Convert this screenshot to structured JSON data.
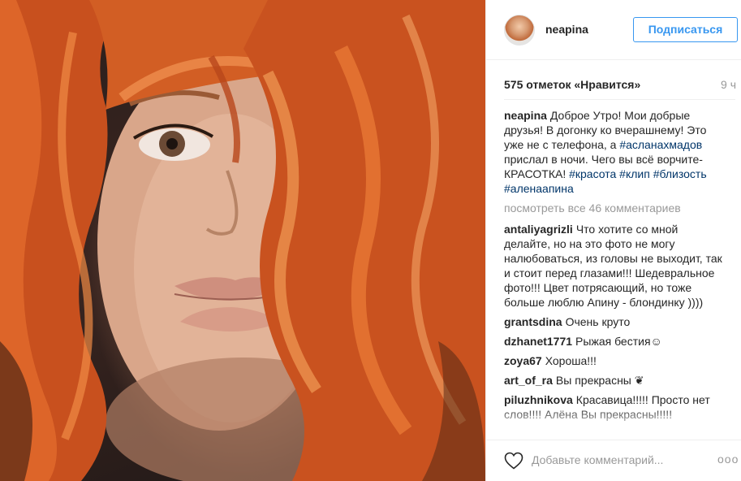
{
  "post": {
    "image_alt": "portrait"
  },
  "header": {
    "username": "neapina",
    "follow_label": "Подписаться"
  },
  "meta": {
    "likes": "575 отметок «Нравится»",
    "time": "9 ч"
  },
  "caption": {
    "author": "neapina",
    "text_1": "Доброе Утро! Мои добрые друзья! В догонку ко вчерашнему! Это уже не с телефона, а ",
    "tag_1": "#асланахмадов",
    "text_2": " прислал в ночи. Чего вы всё ворчите- КРАСОТКА! ",
    "tag_2": "#красота",
    "tag_3": "#клип",
    "tag_4": "#близость",
    "tag_5": "#аленаапина"
  },
  "load_more": "посмотреть все 46 комментариев",
  "comments": [
    {
      "author": "antaliyagrizli",
      "text": "Что хотите со мной делайте, но на это фото не могу налюбоваться, из головы не выходит, так и стоит перед глазами!!! Шедевральное фото!!! Цвет потрясающий, но тоже больше люблю Апину - блондинку ))))"
    },
    {
      "author": "grantsdina",
      "text": "Очень круто"
    },
    {
      "author": "dzhanet1771",
      "text": "Рыжая бестия☺"
    },
    {
      "author": "zoya67",
      "text": "Хороша!!!"
    },
    {
      "author": "art_of_ra",
      "text": "Вы прекрасны ❦"
    },
    {
      "author": "piluzhnikova",
      "text": "Красавица!!!!! Просто нет слов!!!! Алёна Вы прекрасны!!!!!"
    }
  ],
  "footer": {
    "comment_placeholder": "Добавьте комментарий...",
    "more_label": "ооо"
  },
  "icons": {
    "like": "heart-icon",
    "options": "more-options-icon"
  }
}
